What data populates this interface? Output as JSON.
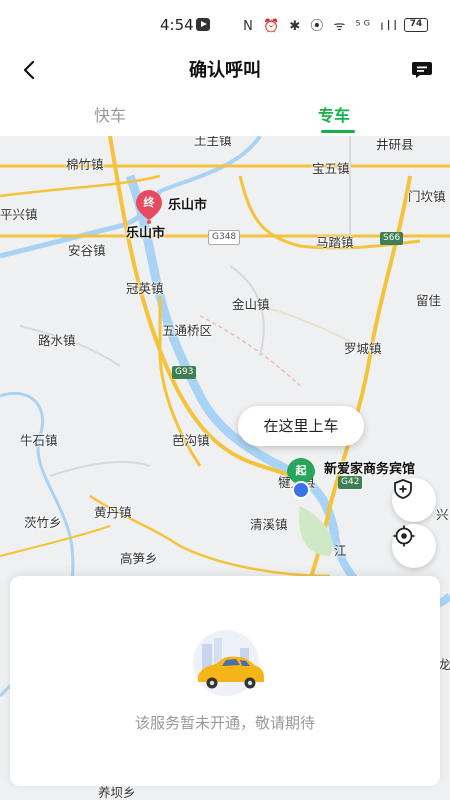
{
  "status_bar": {
    "time": "4:54",
    "battery": "74",
    "signal_icons": "N ⏰ ✱ ⦿ ᯤ ⁵ᴳ ıll"
  },
  "header": {
    "title": "确认呼叫"
  },
  "tabs": [
    {
      "label": "快车"
    },
    {
      "label": "专车"
    }
  ],
  "map": {
    "places": [
      "土主镇",
      "井研县",
      "棉竹镇",
      "宝五镇",
      "门坎镇",
      "平兴镇",
      "乐山市",
      "乐山市",
      "马踏镇",
      "安谷镇",
      "冠英镇",
      "金山镇",
      "留佳",
      "五通桥区",
      "路水镇",
      "罗城镇",
      "牛石镇",
      "芭沟镇",
      "黄丹镇",
      "茨竹乡",
      "清溪镇",
      "高笋乡",
      "犍为县",
      "兴",
      "养坝乡",
      "龙",
      "江"
    ],
    "road_tags": [
      "G348",
      "S66",
      "G93",
      "G42"
    ],
    "destination_marker": "终",
    "start_marker": "起",
    "start_place": "新爱家商务宾馆",
    "pickup_bubble": "在这里上车"
  },
  "panel": {
    "message": "该服务暂未开通，敬请期待"
  },
  "colors": {
    "accent": "#15b14b",
    "destination": "#e84a5f",
    "start": "#2aa65c"
  }
}
